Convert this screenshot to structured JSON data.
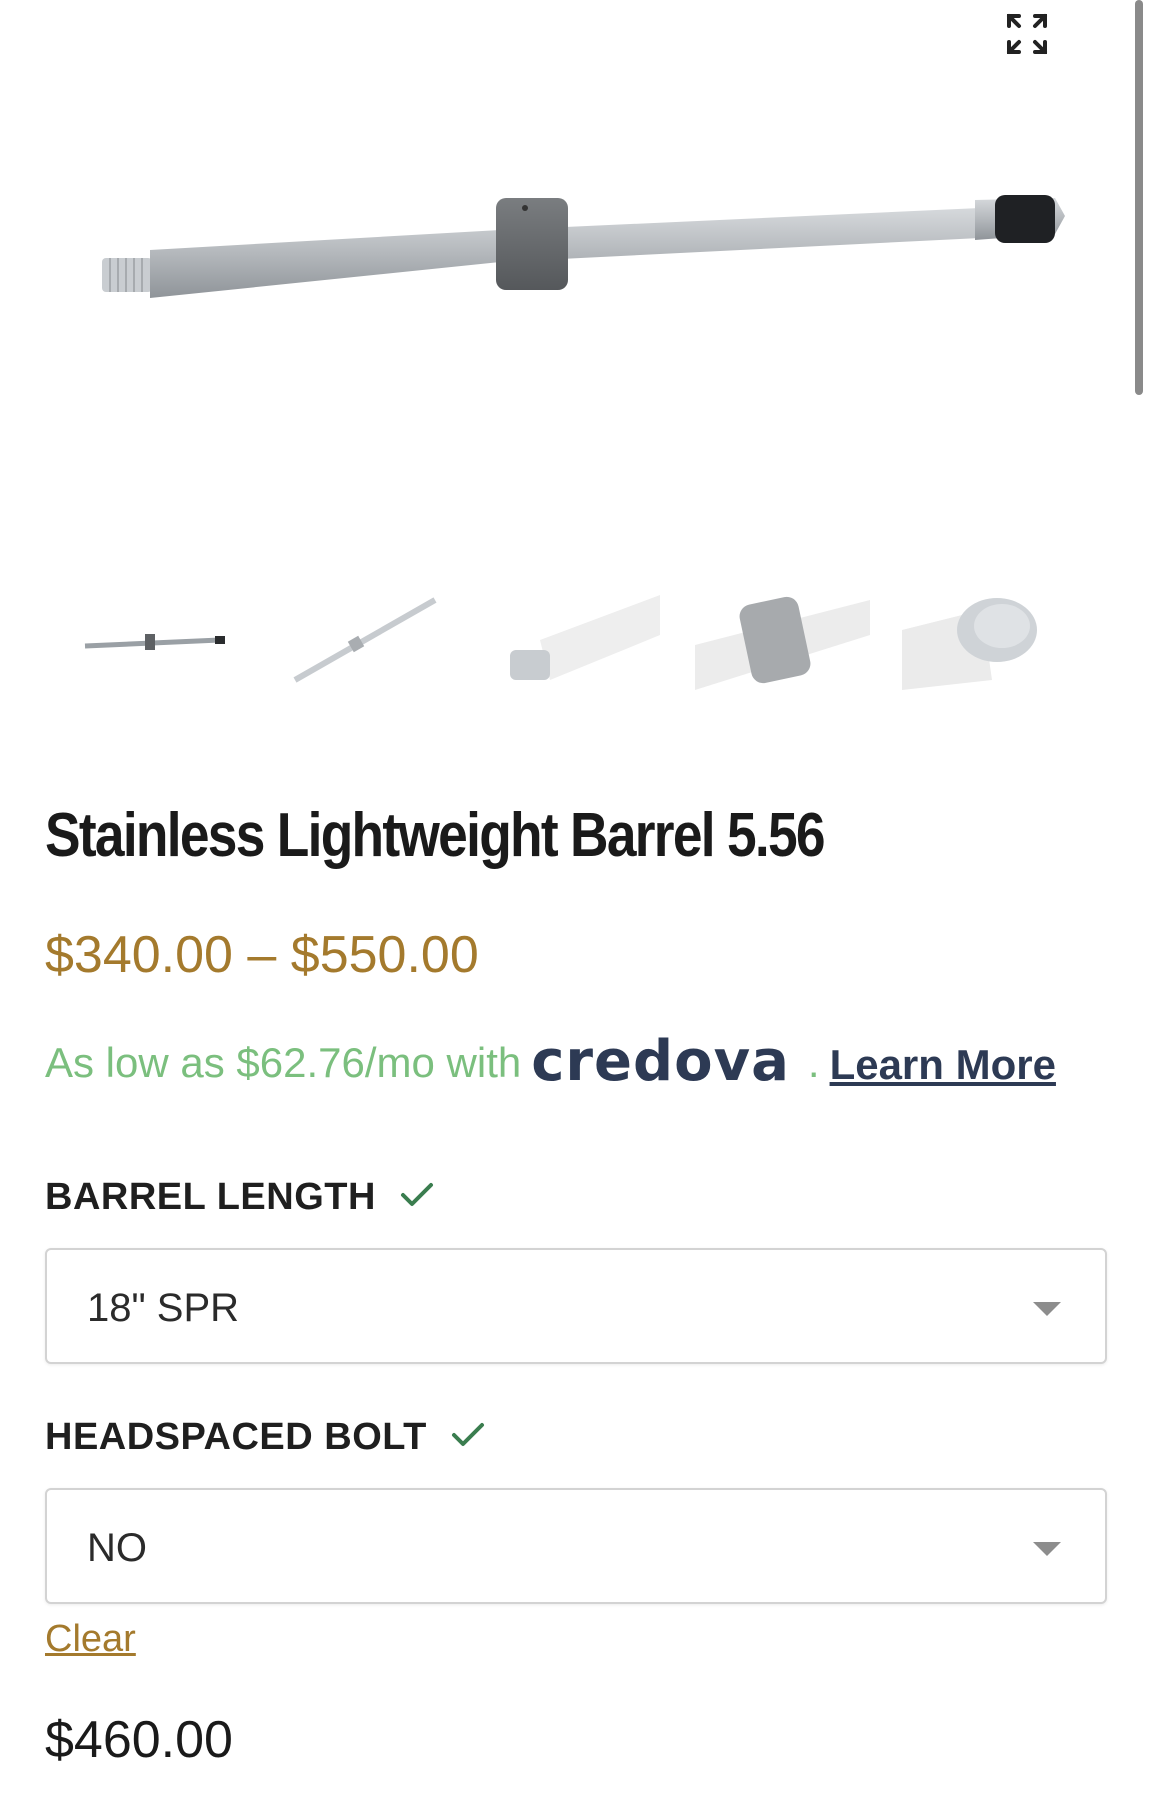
{
  "gallery": {
    "expand_icon": "expand-icon",
    "thumbnails": [
      {
        "name": "thumb-full-barrel"
      },
      {
        "name": "thumb-angled-barrel"
      },
      {
        "name": "thumb-muzzle-detail"
      },
      {
        "name": "thumb-gas-block-detail"
      },
      {
        "name": "thumb-chamber-detail"
      }
    ]
  },
  "product": {
    "title": "Stainless Lightweight Barrel 5.56",
    "price_range": "$340.00 – $550.00",
    "financing": {
      "text": "As low as $62.76/mo with",
      "brand": "credova",
      "separator": ".",
      "link_label": "Learn More"
    }
  },
  "options": {
    "barrel_length": {
      "label": "BARREL LENGTH",
      "value": "18\" SPR",
      "check_icon": "check-icon"
    },
    "headspaced_bolt": {
      "label": "HEADSPACED BOLT",
      "value": "NO",
      "check_icon": "check-icon"
    },
    "clear_label": "Clear"
  },
  "variation": {
    "price": "$460.00"
  },
  "colors": {
    "price_gold": "#a47a2d",
    "financing_green": "#7bbf7e",
    "credova_navy": "#2d3a54",
    "check_green": "#3a7d4f"
  }
}
